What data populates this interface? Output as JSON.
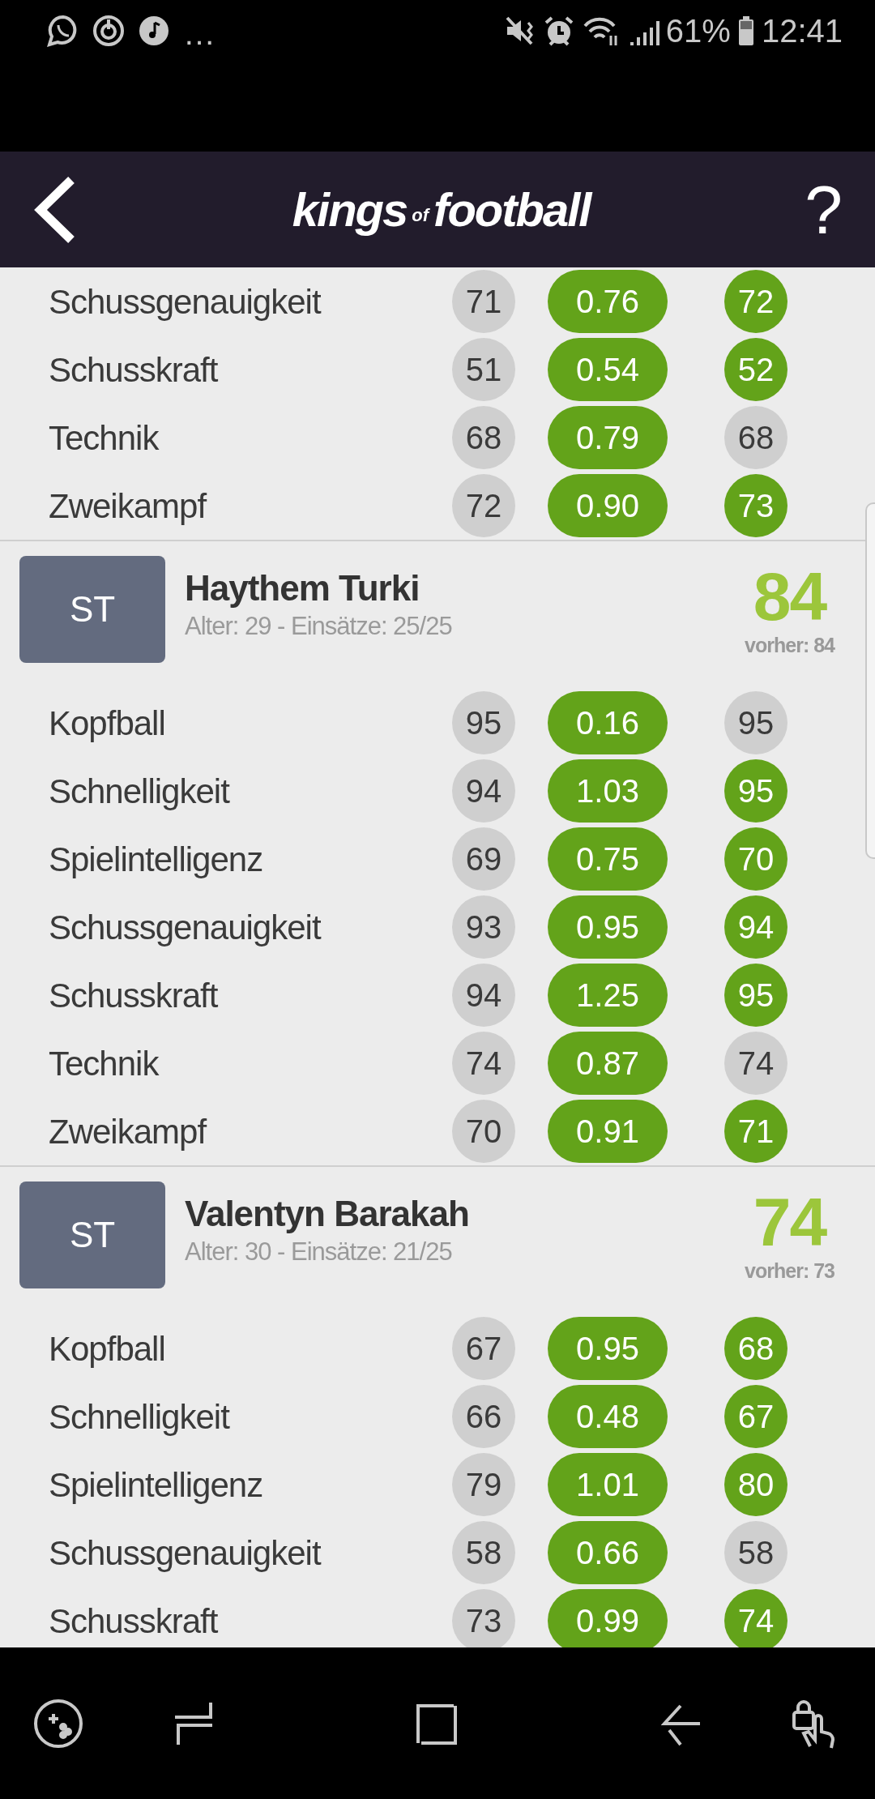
{
  "status_bar": {
    "more": "…",
    "battery": "61%",
    "time": "12:41"
  },
  "header": {
    "logo": [
      "kings",
      "of",
      "football"
    ],
    "help": "?"
  },
  "sections": [
    {
      "rows": [
        {
          "label": "Schussgenauigkeit",
          "before": "71",
          "change": "0.76",
          "after": "72",
          "improved": true
        },
        {
          "label": "Schusskraft",
          "before": "51",
          "change": "0.54",
          "after": "52",
          "improved": true
        },
        {
          "label": "Technik",
          "before": "68",
          "change": "0.79",
          "after": "68",
          "improved": false
        },
        {
          "label": "Zweikampf",
          "before": "72",
          "change": "0.90",
          "after": "73",
          "improved": true
        }
      ]
    },
    {
      "player": {
        "position": "ST",
        "name": "Haythem Turki",
        "info": "Alter: 29 - Einsätze: 25/25",
        "rating": "84",
        "previous": "vorher: 84"
      },
      "rows": [
        {
          "label": "Kopfball",
          "before": "95",
          "change": "0.16",
          "after": "95",
          "improved": false
        },
        {
          "label": "Schnelligkeit",
          "before": "94",
          "change": "1.03",
          "after": "95",
          "improved": true
        },
        {
          "label": "Spielintelligenz",
          "before": "69",
          "change": "0.75",
          "after": "70",
          "improved": true
        },
        {
          "label": "Schussgenauigkeit",
          "before": "93",
          "change": "0.95",
          "after": "94",
          "improved": true
        },
        {
          "label": "Schusskraft",
          "before": "94",
          "change": "1.25",
          "after": "95",
          "improved": true
        },
        {
          "label": "Technik",
          "before": "74",
          "change": "0.87",
          "after": "74",
          "improved": false
        },
        {
          "label": "Zweikampf",
          "before": "70",
          "change": "0.91",
          "after": "71",
          "improved": true
        }
      ]
    },
    {
      "player": {
        "position": "ST",
        "name": "Valentyn Barakah",
        "info": "Alter: 30 - Einsätze: 21/25",
        "rating": "74",
        "previous": "vorher: 73"
      },
      "rows": [
        {
          "label": "Kopfball",
          "before": "67",
          "change": "0.95",
          "after": "68",
          "improved": true
        },
        {
          "label": "Schnelligkeit",
          "before": "66",
          "change": "0.48",
          "after": "67",
          "improved": true
        },
        {
          "label": "Spielintelligenz",
          "before": "79",
          "change": "1.01",
          "after": "80",
          "improved": true
        },
        {
          "label": "Schussgenauigkeit",
          "before": "58",
          "change": "0.66",
          "after": "58",
          "improved": false
        },
        {
          "label": "Schusskraft",
          "before": "73",
          "change": "0.99",
          "after": "74",
          "improved": true
        }
      ]
    }
  ]
}
